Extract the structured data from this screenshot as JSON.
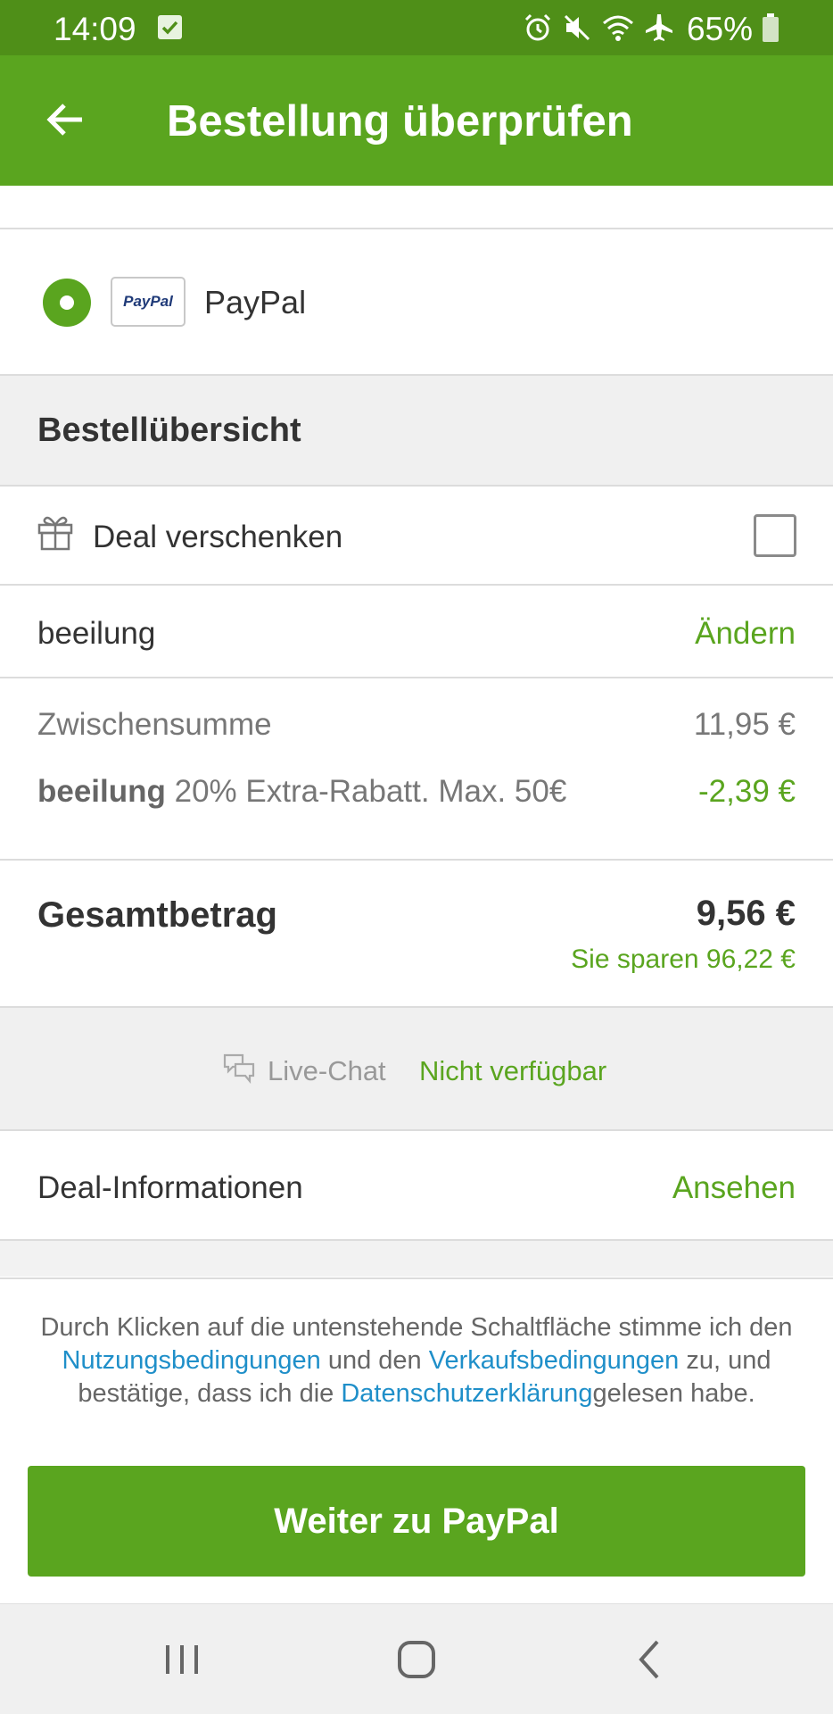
{
  "status_bar": {
    "time": "14:09",
    "battery": "65%",
    "icons": [
      "check-icon",
      "alarm-icon",
      "mute-icon",
      "wifi-icon",
      "airplane-icon",
      "battery-icon"
    ]
  },
  "app_bar": {
    "title": "Bestellung überprüfen",
    "back_icon": "arrow-left-icon"
  },
  "payment": {
    "logo_text": "PayPal",
    "label": "PayPal",
    "selected": true
  },
  "summary": {
    "heading": "Bestellübersicht",
    "gift_label": "Deal verschenken",
    "gift_checked": false,
    "coupon_code": "beeilung",
    "coupon_change": "Ändern",
    "subtotal_label": "Zwischensumme",
    "subtotal_value": "11,95 €",
    "discount_code": "beeilung",
    "discount_text": " 20% Extra-Rabatt. Max. 50€",
    "discount_value": "-2,39 €",
    "total_label": "Gesamtbetrag",
    "total_value": "9,56 €",
    "savings": "Sie sparen 96,22 €"
  },
  "live_chat": {
    "label": "Live-Chat",
    "status": "Nicht verfügbar"
  },
  "deal_info": {
    "label": "Deal-Informationen",
    "link": "Ansehen"
  },
  "legal": {
    "part1": "Durch Klicken auf die untenstehende Schaltfläche stimme ich den ",
    "link_terms": "Nutzungsbedingungen",
    "part2": " und den ",
    "link_sales": "Verkaufsbedingungen",
    "part3": " zu, und bestätige, dass ich die ",
    "link_privacy": "Datenschutzerklärung",
    "part4": "gelesen habe."
  },
  "cta": {
    "label": "Weiter zu PayPal"
  },
  "nav_bar": {
    "buttons": [
      "recent-apps-icon",
      "home-icon",
      "back-icon"
    ]
  },
  "colors": {
    "status_bar": "#4f8f18",
    "app_bar": "#5aa51f",
    "accent_green": "#5aa51f",
    "link_blue": "#1f8fc9"
  }
}
